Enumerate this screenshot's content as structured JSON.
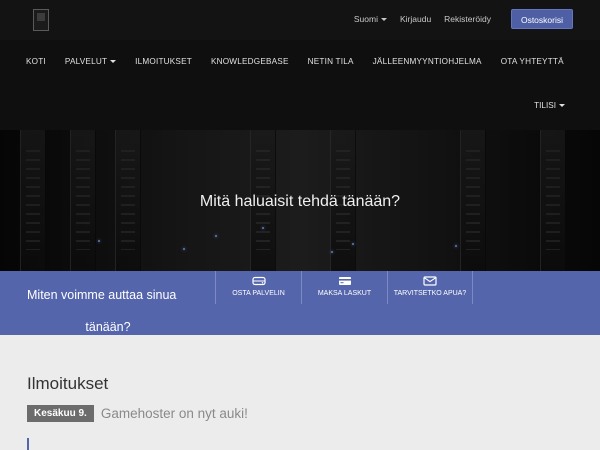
{
  "header": {
    "language_label": "Suomi",
    "login_label": "Kirjaudu",
    "register_label": "Rekisteröidy",
    "cart_label": "Ostoskorisi"
  },
  "nav": {
    "items": [
      {
        "label": "KOTI"
      },
      {
        "label": "PALVELUT"
      },
      {
        "label": "ILMOITUKSET"
      },
      {
        "label": "KNOWLEDGEBASE"
      },
      {
        "label": "NETIN TILA"
      },
      {
        "label": "JÄLLEENMYYNTIOHJELMA"
      },
      {
        "label": "OTA YHTEYTTÄ"
      }
    ],
    "account_label": "TILISI"
  },
  "hero": {
    "title": "Mitä haluaisit tehdä tänään?"
  },
  "help": {
    "line1": "Miten voimme auttaa sinua",
    "line2": "tänään?",
    "tiles": [
      {
        "label": "OSTA PALVELIN",
        "icon": "server-icon"
      },
      {
        "label": "MAKSA LASKUT",
        "icon": "credit-card-icon"
      },
      {
        "label": "TARVITSETKO APUA?",
        "icon": "envelope-icon"
      }
    ]
  },
  "announcements": {
    "heading": "Ilmoitukset",
    "items": [
      {
        "date": "Kesäkuu 9.",
        "title": "Gamehoster on nyt auki!"
      }
    ]
  },
  "colors": {
    "accent": "#5565ab",
    "topbar": "#131313",
    "badge": "#6c6c6c"
  }
}
